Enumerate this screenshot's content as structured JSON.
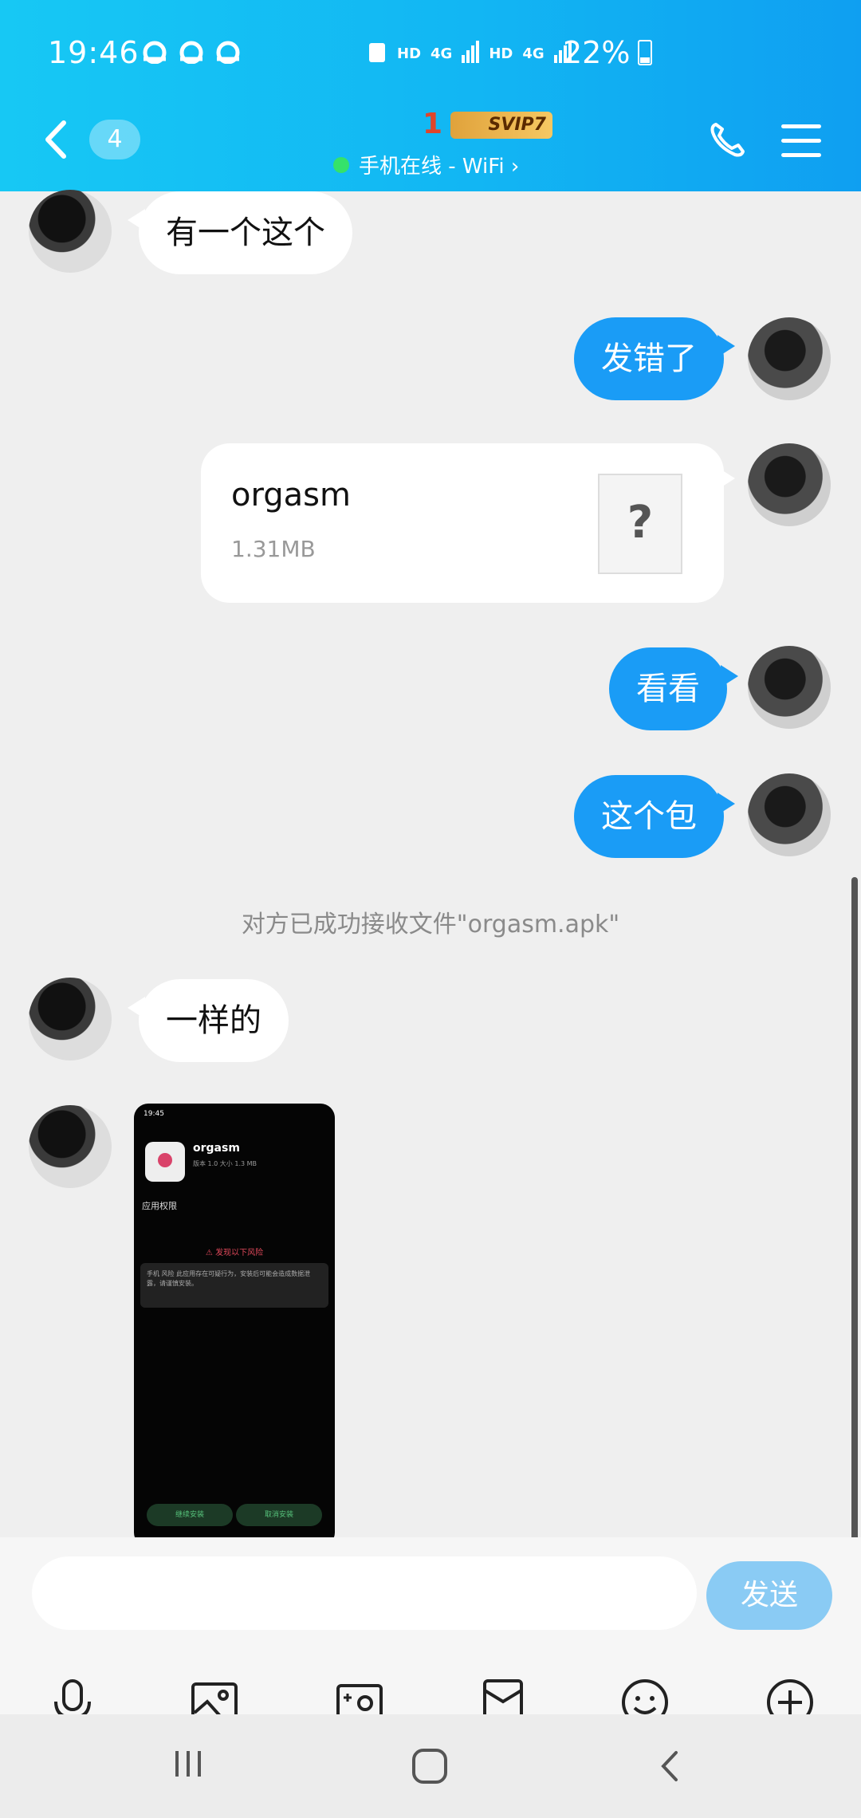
{
  "status_bar": {
    "time": "19:46",
    "net1": "HD",
    "net1_type": "4G",
    "net2": "HD",
    "net2_type": "4G",
    "battery": "22%"
  },
  "header": {
    "unread_count": "4",
    "contact_name": "1",
    "svip_badge": "SVIP7",
    "online_status": "手机在线 - WiFi ›",
    "online_color": "#35e26a"
  },
  "messages": [
    {
      "from": "other",
      "type": "text",
      "text": "有一个这个"
    },
    {
      "from": "me",
      "type": "text",
      "text": "发错了"
    },
    {
      "from": "me",
      "type": "file",
      "file_name": "orgasm",
      "file_size": "1.31MB",
      "file_icon": "?"
    },
    {
      "from": "me",
      "type": "text",
      "text": "看看"
    },
    {
      "from": "me",
      "type": "text",
      "text": "这个包"
    },
    {
      "from": "system",
      "type": "notice",
      "text": "对方已成功接收文件\"orgasm.apk\""
    },
    {
      "from": "other",
      "type": "text",
      "text": "一样的"
    },
    {
      "from": "other",
      "type": "image",
      "shot": {
        "time": "19:45",
        "app_name": "orgasm",
        "app_meta": "版本   1.0   大小   1.3 MB",
        "perm_label": "应用权限",
        "risk_title": "⚠ 发现以下风险",
        "risk_desc": "手机    风险 此应用存在可疑行为，安装后可能会造成数据泄露，请谨慎安装。",
        "btn_continue": "继续安装",
        "btn_cancel": "取消安装"
      }
    }
  ],
  "composer": {
    "input_placeholder": "",
    "send_label": "发送"
  },
  "toolbar_icons": [
    "microphone-icon",
    "image-icon",
    "camera-icon",
    "red-packet-icon",
    "emoji-icon",
    "plus-icon"
  ],
  "colors": {
    "accent": "#1a9cf6",
    "header": "#12b6f3",
    "send_disabled": "#8acbf4"
  }
}
